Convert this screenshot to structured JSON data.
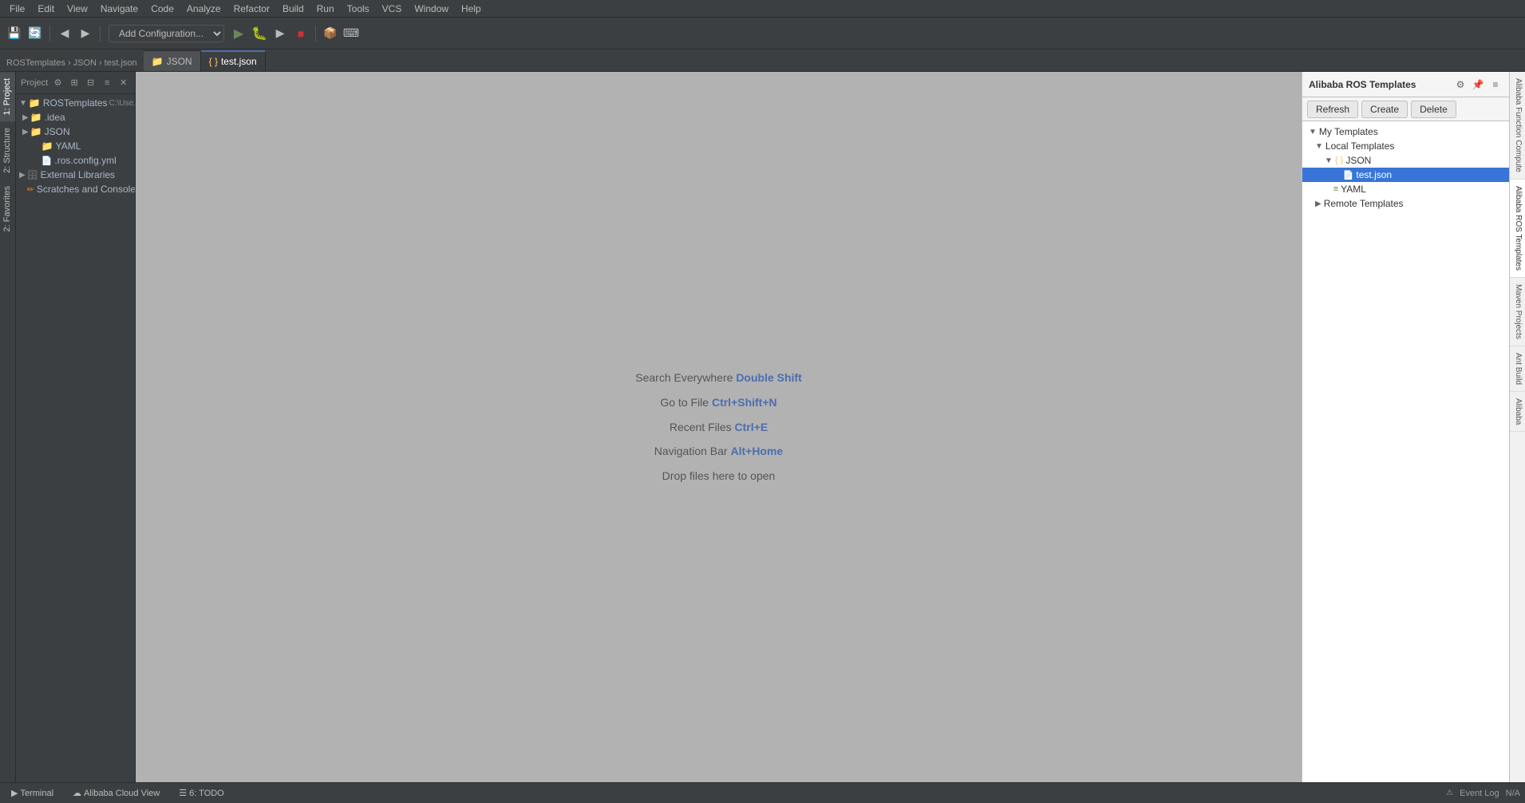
{
  "app": {
    "title": "ROSTemplates"
  },
  "menubar": {
    "items": [
      "File",
      "Edit",
      "View",
      "Navigate",
      "Code",
      "Analyze",
      "Refactor",
      "Build",
      "Run",
      "Tools",
      "VCS",
      "Window",
      "Help"
    ]
  },
  "toolbar": {
    "run_config": "Add Configuration...",
    "buttons": [
      "save-all",
      "sync",
      "back",
      "forward",
      "run",
      "debug",
      "stop",
      "coverage",
      "build-artifact",
      "terminal"
    ]
  },
  "file_tabs": {
    "breadcrumb": [
      "ROSTemplates",
      "JSON",
      "test.json"
    ],
    "tabs": [
      {
        "label": "JSON",
        "icon": "folder"
      },
      {
        "label": "test.json",
        "icon": "json",
        "active": true
      }
    ]
  },
  "sidebar": {
    "title": "Project",
    "root": "ROSTemplates",
    "root_path": "C:\\Use...",
    "items": [
      {
        "label": ".idea",
        "type": "folder",
        "indent": 1,
        "arrow": "▶"
      },
      {
        "label": "JSON",
        "type": "folder",
        "indent": 1,
        "arrow": "▶"
      },
      {
        "label": "YAML",
        "type": "folder",
        "indent": 2,
        "arrow": ""
      },
      {
        "label": ".ros.config.yml",
        "type": "yaml-file",
        "indent": 2
      },
      {
        "label": "External Libraries",
        "type": "libs",
        "indent": 0,
        "arrow": "▶"
      },
      {
        "label": "Scratches and Console",
        "type": "scratches",
        "indent": 0,
        "arrow": ""
      }
    ]
  },
  "editor": {
    "placeholder_lines": [
      {
        "text": "Search Everywhere",
        "shortcut": "Double Shift"
      },
      {
        "text": "Go to File",
        "shortcut": "Ctrl+Shift+N"
      },
      {
        "text": "Recent Files",
        "shortcut": "Ctrl+E"
      },
      {
        "text": "Navigation Bar",
        "shortcut": "Alt+Home"
      },
      {
        "text": "Drop files here to open",
        "shortcut": ""
      }
    ]
  },
  "right_panel": {
    "title": "Alibaba ROS Templates",
    "buttons": {
      "refresh": "Refresh",
      "create": "Create",
      "delete": "Delete"
    },
    "tree": {
      "my_templates": "My Templates",
      "local_templates": "Local Templates",
      "json_folder": "JSON",
      "test_json": "test.json",
      "yaml": "YAML",
      "remote_templates": "Remote Templates"
    }
  },
  "right_vtabs": [
    "Alibaba Function Compute",
    "Alibaba ROS Templates",
    "Maven Projects",
    "Ant Build",
    "Alibaba"
  ],
  "bottom_bar": {
    "tabs": [
      {
        "label": "Terminal",
        "icon": "▶",
        "active": false
      },
      {
        "label": "Alibaba Cloud View",
        "icon": "☁",
        "active": false
      },
      {
        "label": "6: TODO",
        "icon": "☰",
        "active": false
      }
    ],
    "status": {
      "event_log": "Event Log",
      "location": "N/A"
    }
  }
}
